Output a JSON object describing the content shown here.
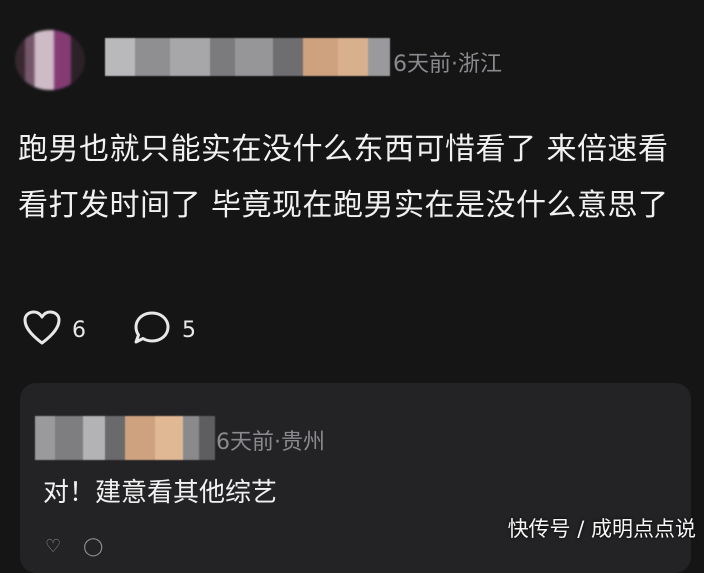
{
  "post": {
    "meta": "6天前·浙江",
    "text": "跑男也就只能实在没什么东西可惜看了 来倍速看看打发时间了 毕竟现在跑男实在是没什么意思了",
    "like_count": "6",
    "comment_count": "5",
    "like_icon": "heart-icon",
    "comment_icon": "speech-bubble-icon"
  },
  "reply": {
    "meta": "6天前·贵州",
    "text": "对！建意看其他综艺"
  },
  "watermark": "快传号 / 成明点点说",
  "colors": {
    "background": "#151516",
    "card": "#232325",
    "meta_text": "#8a8a8e",
    "body_text": "#f1f1f1"
  }
}
